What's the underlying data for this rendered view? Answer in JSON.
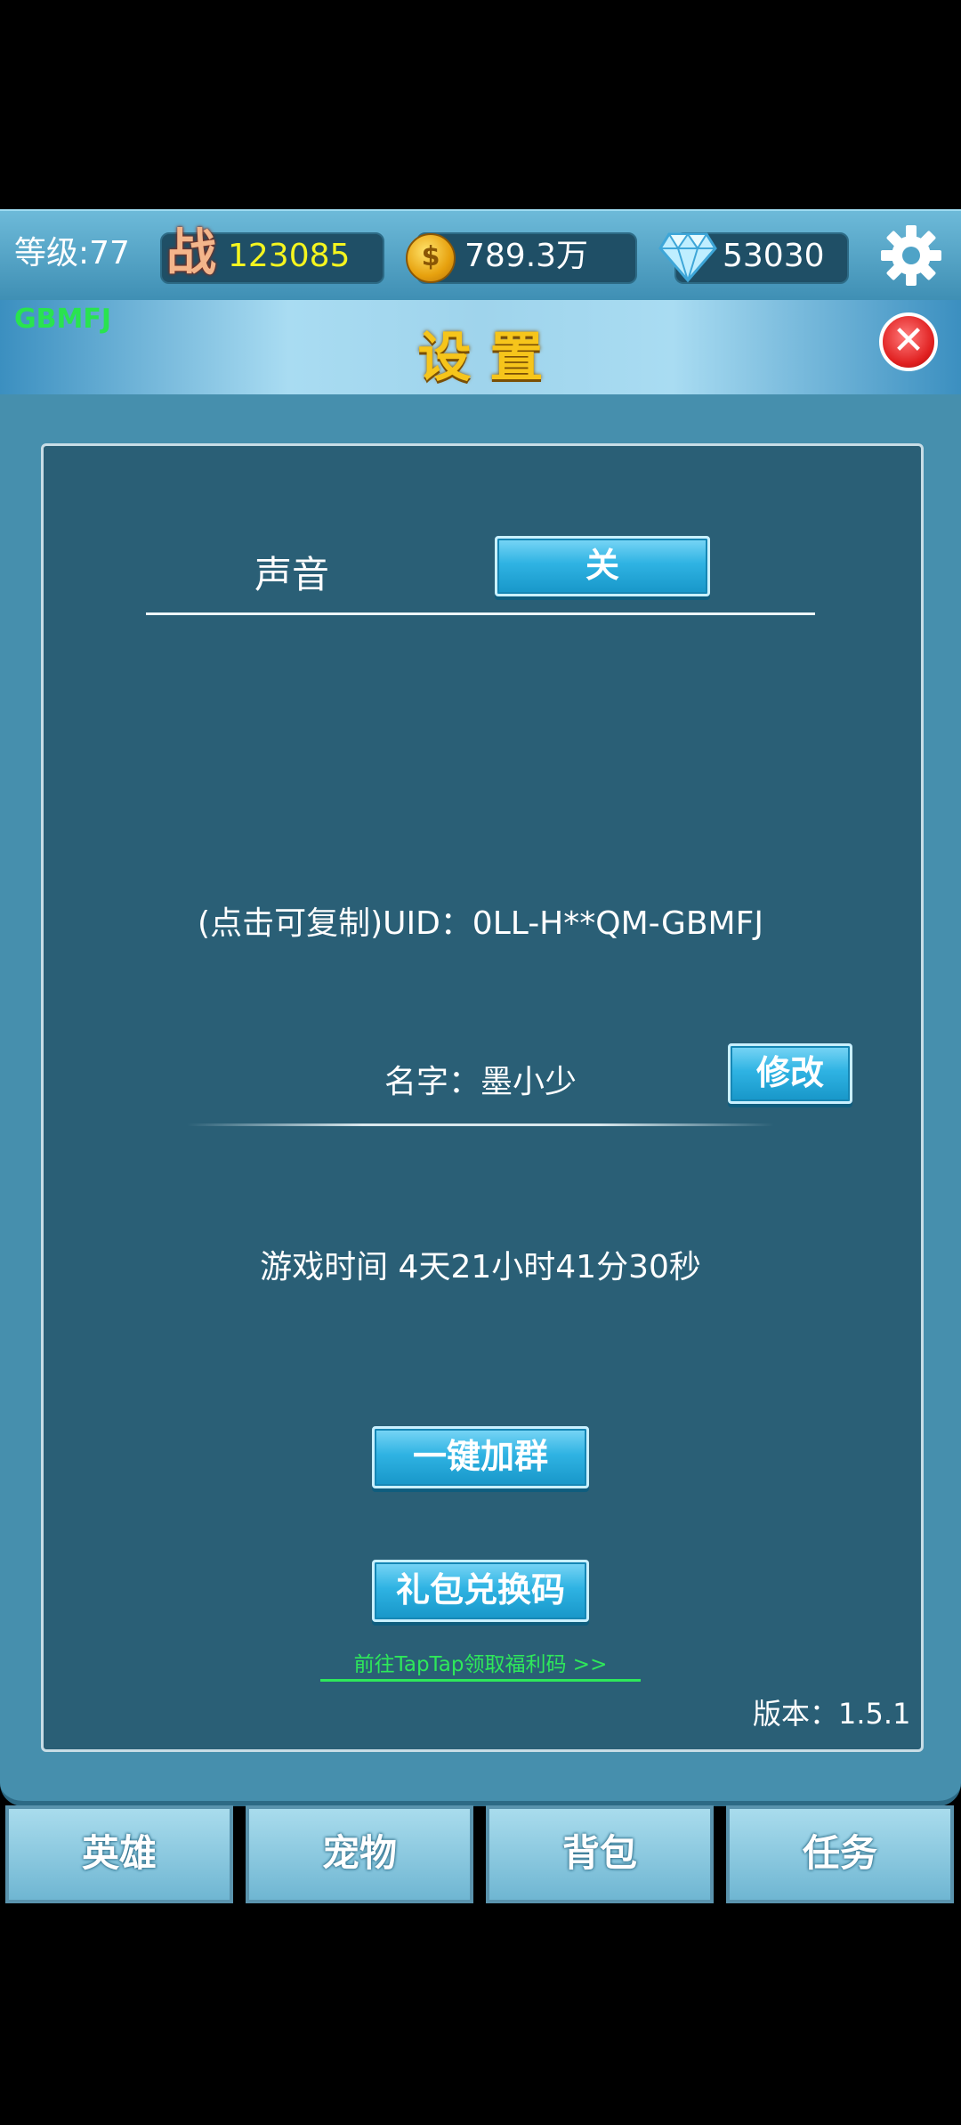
{
  "topbar": {
    "level": "等级:77",
    "battle_icon_text": "战",
    "battle_power": "123085",
    "gold": "789.3万",
    "diamonds": "53030"
  },
  "header": {
    "player_code": "GBMFJ",
    "title": "设 置"
  },
  "settings": {
    "sound_label": "声音",
    "sound_toggle": "关",
    "uid_text": "(点击可复制)UID：0LL-H**QM-GBMFJ",
    "name_text": "名字：墨小少",
    "modify_button": "修改",
    "playtime_text": "游戏时间 4天21小时41分30秒",
    "join_group_button": "一键加群",
    "gift_code_button": "礼包兑换码",
    "taptap_link": "前往TapTap领取福利码 >>",
    "version_text": "版本：1.5.1"
  },
  "tabs": [
    "英雄",
    "宠物",
    "背包",
    "任务"
  ],
  "colors": {
    "panel_dark": "#2a5f76",
    "panel_outer": "#468fad",
    "button_blue": "#2fb3e3",
    "title_gold": "#f6c51b",
    "link_green": "#2ee85a",
    "player_code_green": "#29e34f",
    "battle_yellow": "#f5f51f"
  }
}
